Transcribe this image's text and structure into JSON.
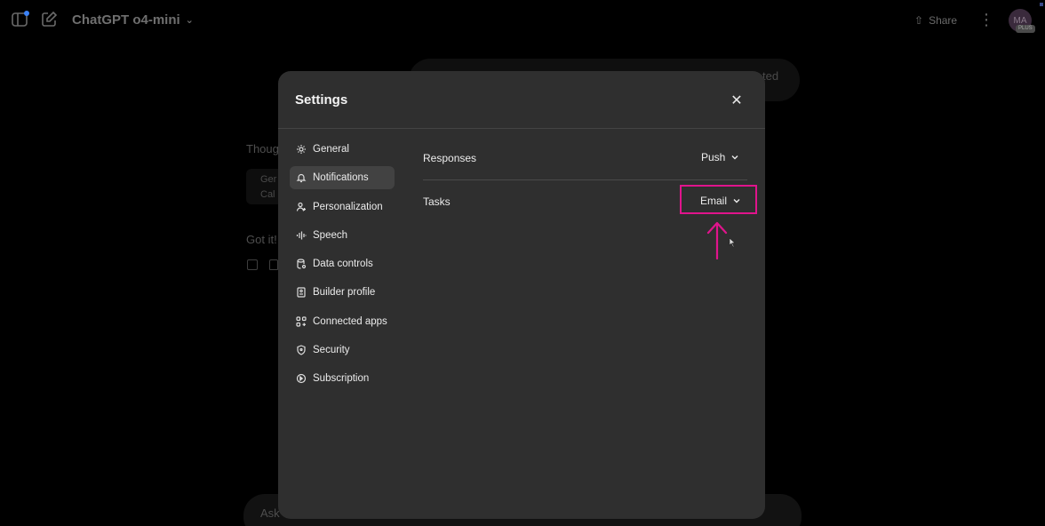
{
  "topbar": {
    "model_title": "ChatGPT o4-mini",
    "share_label": "Share",
    "avatar_initials": "MA",
    "plan_badge": "PLUS"
  },
  "background_chat": {
    "bubble_fragment": "ted",
    "thought_fragment": "Thoug",
    "card_line1": "Ger",
    "card_line2": "Cal",
    "reply_fragment": "Got it!",
    "composer_placeholder_fragment": "Ask"
  },
  "settings": {
    "title": "Settings",
    "nav": [
      {
        "label": "General",
        "icon": "gear-icon",
        "active": false
      },
      {
        "label": "Notifications",
        "icon": "bell-icon",
        "active": true
      },
      {
        "label": "Personalization",
        "icon": "person-icon",
        "active": false
      },
      {
        "label": "Speech",
        "icon": "waveform-icon",
        "active": false
      },
      {
        "label": "Data controls",
        "icon": "database-icon",
        "active": false
      },
      {
        "label": "Builder profile",
        "icon": "id-card-icon",
        "active": false
      },
      {
        "label": "Connected apps",
        "icon": "apps-grid-icon",
        "active": false
      },
      {
        "label": "Security",
        "icon": "shield-icon",
        "active": false
      },
      {
        "label": "Subscription",
        "icon": "subscription-icon",
        "active": false
      }
    ],
    "notifications": {
      "responses": {
        "label": "Responses",
        "value": "Push"
      },
      "tasks": {
        "label": "Tasks",
        "value": "Email"
      }
    }
  },
  "annotation": {
    "highlight_color": "#e0148c"
  }
}
